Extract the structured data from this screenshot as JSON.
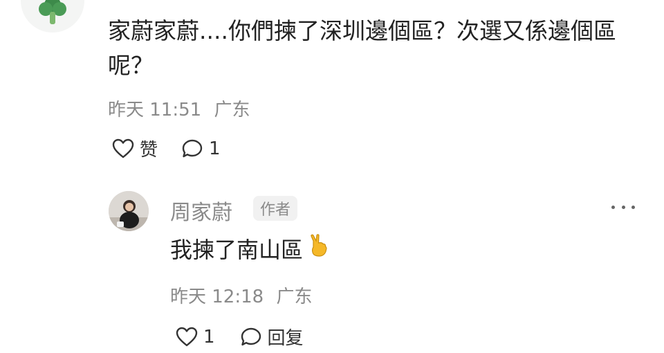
{
  "comment": {
    "avatar_icon": "broccoli-icon",
    "text": "家蔚家蔚....你們揀了深圳邊個區？次選又係邊個區呢？",
    "time": "昨天 11:51",
    "location": "广东",
    "like_label": "赞",
    "reply_count": "1"
  },
  "reply": {
    "author_name": "周家蔚",
    "author_badge": "作者",
    "text": "我揀了南山區",
    "emoji_icon": "victory-hand-icon",
    "emoji_color": "#f5b828",
    "time": "昨天 12:18",
    "location": "广东",
    "like_count": "1",
    "reply_label": "回复"
  }
}
